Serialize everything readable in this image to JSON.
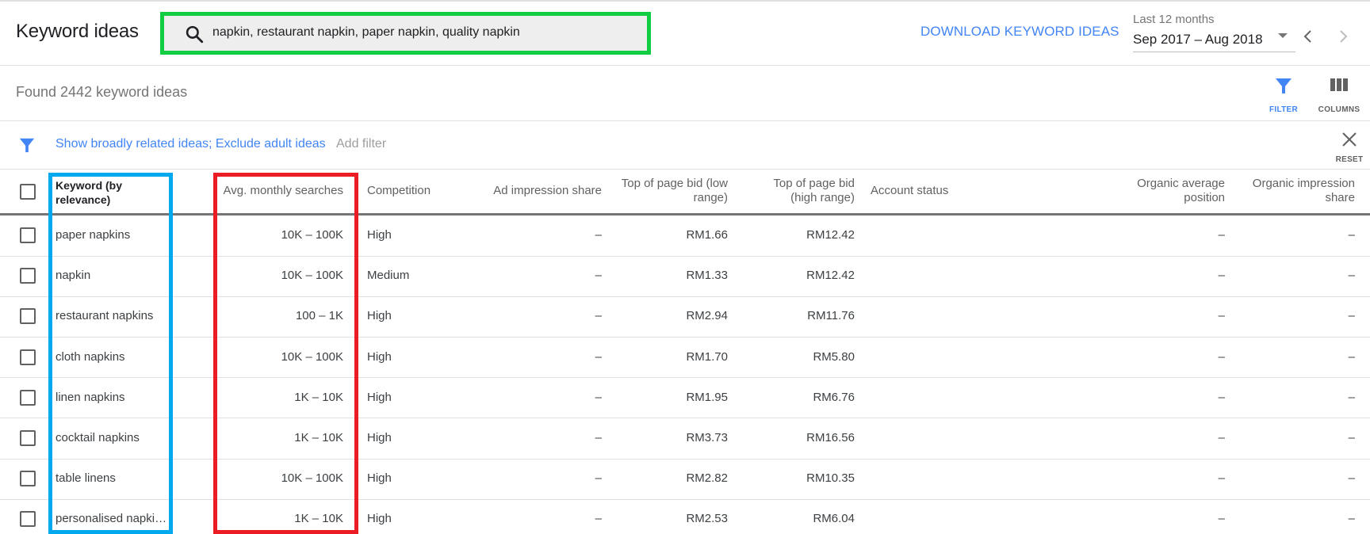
{
  "header": {
    "title": "Keyword ideas",
    "search_value": "napkin, restaurant napkin, paper napkin, quality napkin",
    "download_label": "DOWNLOAD KEYWORD IDEAS",
    "period_label": "Last 12 months",
    "period_value": "Sep 2017 – Aug 2018"
  },
  "summary": {
    "found_text": "Found 2442 keyword ideas"
  },
  "toolbar": {
    "filter_label": "FILTER",
    "columns_label": "COLUMNS",
    "filter_accent": "#4285f4"
  },
  "filters": {
    "active_text": "Show broadly related ideas; Exclude adult ideas",
    "add_filter_label": "Add filter",
    "reset_label": "RESET"
  },
  "table": {
    "columns": [
      {
        "line1": "Keyword (by",
        "line2": "relevance)"
      },
      {
        "line1": "Avg. monthly searches",
        "line2": ""
      },
      {
        "line1": "Competition",
        "line2": ""
      },
      {
        "line1": "Ad impression share",
        "line2": ""
      },
      {
        "line1": "Top of page bid (low",
        "line2": "range)"
      },
      {
        "line1": "Top of page bid",
        "line2": "(high range)"
      },
      {
        "line1": "Account status",
        "line2": ""
      },
      {
        "line1": "Organic average",
        "line2": "position"
      },
      {
        "line1": "Organic impression",
        "line2": "share"
      }
    ],
    "rows": [
      {
        "keyword": "paper napkins",
        "searches": "10K – 100K",
        "competition": "High",
        "ad_share": "–",
        "bid_low": "RM1.66",
        "bid_high": "RM12.42",
        "account_status": "",
        "organic_pos": "–",
        "organic_share": "–"
      },
      {
        "keyword": "napkin",
        "searches": "10K – 100K",
        "competition": "Medium",
        "ad_share": "–",
        "bid_low": "RM1.33",
        "bid_high": "RM12.42",
        "account_status": "",
        "organic_pos": "–",
        "organic_share": "–"
      },
      {
        "keyword": "restaurant napkins",
        "searches": "100 – 1K",
        "competition": "High",
        "ad_share": "–",
        "bid_low": "RM2.94",
        "bid_high": "RM11.76",
        "account_status": "",
        "organic_pos": "–",
        "organic_share": "–"
      },
      {
        "keyword": "cloth napkins",
        "searches": "10K – 100K",
        "competition": "High",
        "ad_share": "–",
        "bid_low": "RM1.70",
        "bid_high": "RM5.80",
        "account_status": "",
        "organic_pos": "–",
        "organic_share": "–"
      },
      {
        "keyword": "linen napkins",
        "searches": "1K – 10K",
        "competition": "High",
        "ad_share": "–",
        "bid_low": "RM1.95",
        "bid_high": "RM6.76",
        "account_status": "",
        "organic_pos": "–",
        "organic_share": "–"
      },
      {
        "keyword": "cocktail napkins",
        "searches": "1K – 10K",
        "competition": "High",
        "ad_share": "–",
        "bid_low": "RM3.73",
        "bid_high": "RM16.56",
        "account_status": "",
        "organic_pos": "–",
        "organic_share": "–"
      },
      {
        "keyword": "table linens",
        "searches": "10K – 100K",
        "competition": "High",
        "ad_share": "–",
        "bid_low": "RM2.82",
        "bid_high": "RM10.35",
        "account_status": "",
        "organic_pos": "–",
        "organic_share": "–"
      },
      {
        "keyword": "personalised napki…",
        "searches": "1K – 10K",
        "competition": "High",
        "ad_share": "–",
        "bid_low": "RM2.53",
        "bid_high": "RM6.04",
        "account_status": "",
        "organic_pos": "–",
        "organic_share": "–"
      }
    ]
  },
  "annotations": {
    "search_box_color": "#12cc41",
    "keyword_column_color": "#00a8ee",
    "searches_column_color": "#ec1c24"
  }
}
